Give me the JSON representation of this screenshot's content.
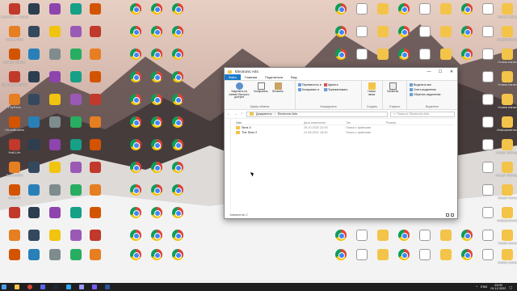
{
  "desktop": {
    "left_labels": [
      "Launcher — ярлык",
      "Kraven Riot",
      "Shadow Warrior",
      "My Time At Portia",
      "PsyRack",
      "GhostBusters",
      "Half-Life",
      "Screenshot",
      "Mafia III"
    ],
    "right_labels": [
      "Новая папка",
      "информатика",
      "Новая папка",
      "Новая папка",
      "Новая папка",
      "Информатика",
      "Новая таблица",
      "Новая таблица"
    ]
  },
  "explorer": {
    "title": "Electronic Arts",
    "window_controls": [
      "—",
      "☐",
      "✕"
    ],
    "tabs": [
      "Файл",
      "Главная",
      "Поделиться",
      "Вид"
    ],
    "ribbon": {
      "clipboard": {
        "pin": "Закрепить на панели быстрого доступа",
        "copy": "Копировать",
        "paste": "Вставить",
        "group": "Буфер обмена"
      },
      "organize": {
        "move_to": "Переместить в",
        "copy_to": "Копировать в",
        "delete": "Удалить",
        "rename": "Переименовать",
        "group": "Упорядочить"
      },
      "create": {
        "new_folder": "Новая папка",
        "group": "Создать"
      },
      "open": {
        "properties": "Свойства",
        "group": "Открыть"
      },
      "select": {
        "select_all": "Выделить все",
        "select_none": "Снять выделение",
        "invert": "Обратить выделение",
        "group": "Выделить"
      }
    },
    "address": {
      "crumbs": [
        "Документы",
        "Electronic Arts"
      ],
      "search_placeholder": "Поиск в: Electronic Arts"
    },
    "columns": [
      "Имя",
      "Дата изменения",
      "Тип",
      "Размер"
    ],
    "rows": [
      {
        "name": "Sims 4",
        "date": "29.10.2022 22:00",
        "type": "Папка с файлами",
        "size": ""
      },
      {
        "name": "The Sims 2",
        "date": "21.08.2021 18:40",
        "type": "Папка с файлами",
        "size": ""
      }
    ],
    "status": "Элементов: 2"
  },
  "taskbar": {
    "lang": "ENG",
    "time": "23:09",
    "date": "01.12.2022"
  }
}
